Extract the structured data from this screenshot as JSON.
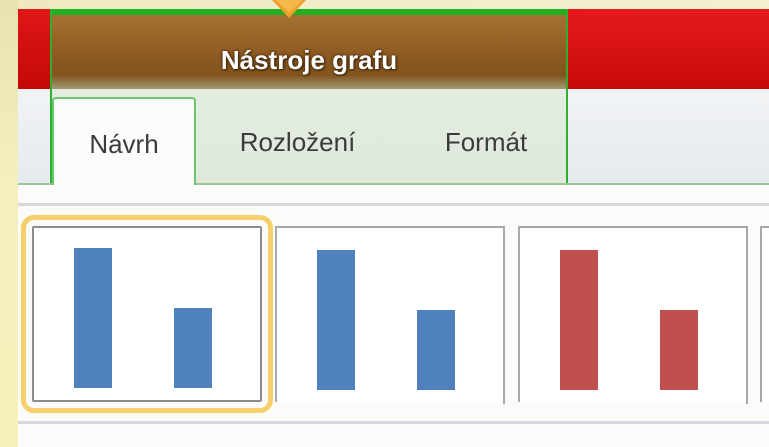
{
  "contextual_group": {
    "title": "Nástroje grafu"
  },
  "tabs": [
    {
      "label": "Návrh",
      "active": true
    },
    {
      "label": "Rozložení",
      "active": false
    },
    {
      "label": "Formát",
      "active": false
    }
  ],
  "chart_styles_gallery": {
    "selected_index": 0,
    "styles": [
      {
        "color": "#4f81bd"
      },
      {
        "color": "#4f81bd"
      },
      {
        "color": "#c0504d"
      }
    ]
  },
  "colors": {
    "contextual_brown": "#8d5a22",
    "contextual_green": "#22b022",
    "selection_gold": "#f5cf6a",
    "chart_blue": "#4f81bd",
    "chart_red": "#c0504d"
  }
}
